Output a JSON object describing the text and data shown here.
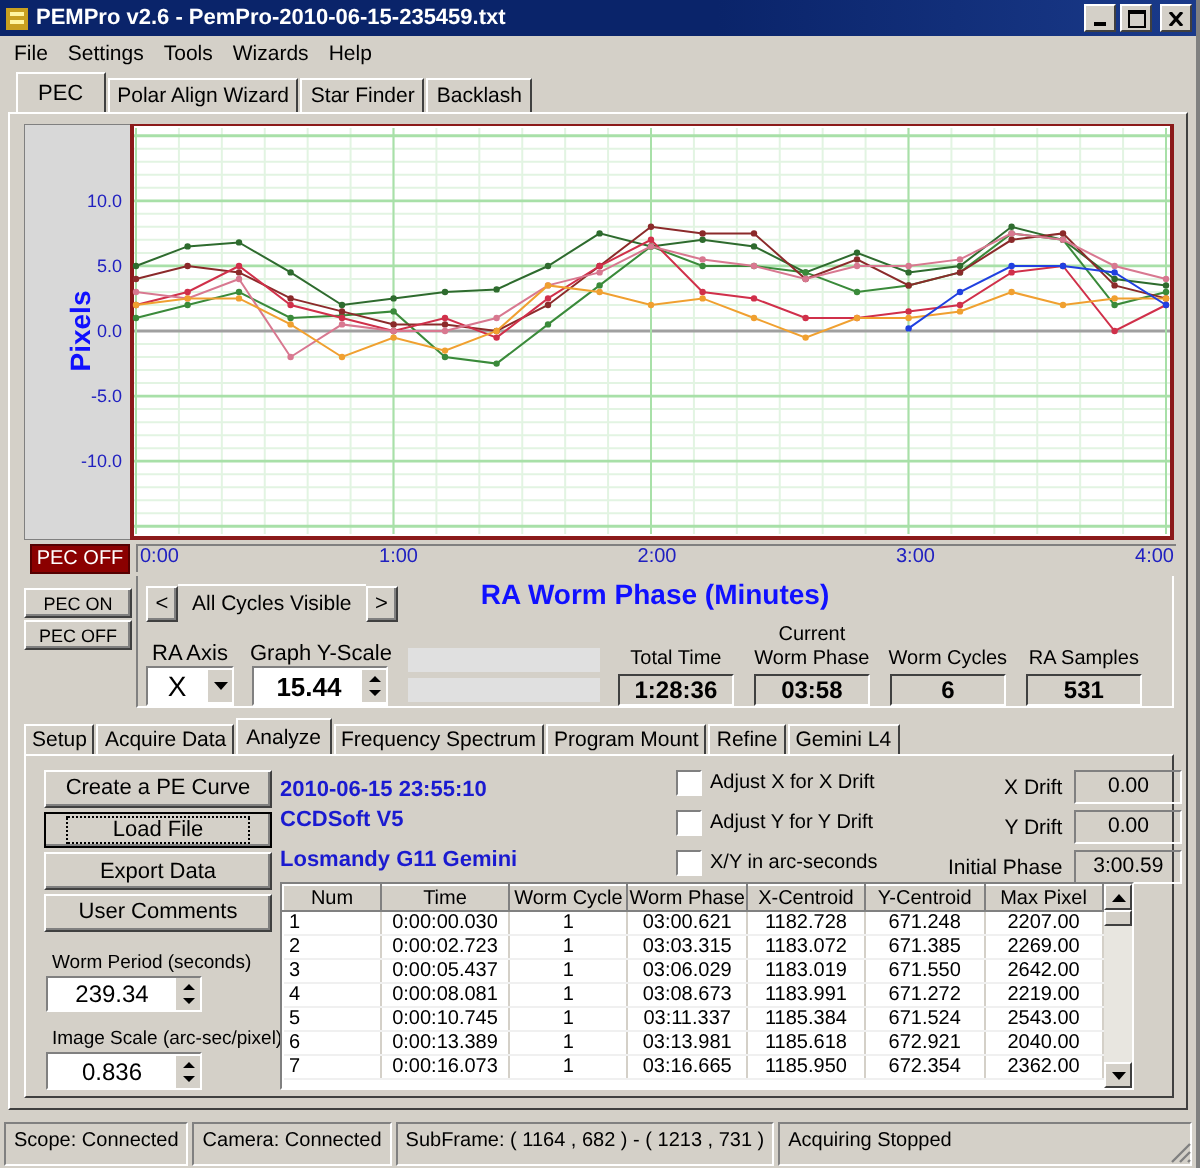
{
  "window": {
    "title": "PEMPro v2.6 - PemPro-2010-06-15-235459.txt"
  },
  "menu": [
    "File",
    "Settings",
    "Tools",
    "Wizards",
    "Help"
  ],
  "tabs": [
    {
      "label": "PEC",
      "selected": true
    },
    {
      "label": "Polar Align Wizard",
      "selected": false
    },
    {
      "label": "Star Finder",
      "selected": false
    },
    {
      "label": "Backlash",
      "selected": false
    }
  ],
  "pec_chart": {
    "status": "PEC OFF",
    "chart_data": {
      "type": "line",
      "grid": true,
      "xlabel": "RA Worm Phase (Minutes)",
      "ylabel": "Pixels",
      "xlim": [
        0,
        4
      ],
      "ylim": [
        -15.44,
        15.44
      ],
      "xticks": [
        {
          "value": 0,
          "label": "0:00"
        },
        {
          "value": 1,
          "label": "1:00"
        },
        {
          "value": 2,
          "label": "2:00"
        },
        {
          "value": 3,
          "label": "3:00"
        },
        {
          "value": 4,
          "label": "4:00"
        }
      ],
      "yticks": [
        {
          "value": 10,
          "label": "10.0"
        },
        {
          "value": 5,
          "label": "5.0"
        },
        {
          "value": 0,
          "label": "0.0"
        },
        {
          "value": -5,
          "label": "-5.0"
        },
        {
          "value": -10,
          "label": "-10.0"
        }
      ],
      "x": [
        0,
        0.2,
        0.4,
        0.6,
        0.8,
        1.0,
        1.2,
        1.4,
        1.6,
        1.8,
        2.0,
        2.2,
        2.4,
        2.6,
        2.8,
        3.0,
        3.2,
        3.4,
        3.6,
        3.8,
        4.0
      ],
      "series": [
        {
          "color": "#2e6b2e",
          "values": [
            5,
            6.5,
            6.8,
            4.5,
            2,
            2.5,
            3,
            3.2,
            5,
            7.5,
            6.5,
            7,
            6.5,
            4.5,
            6,
            4.5,
            5,
            8,
            7,
            4,
            3.5
          ]
        },
        {
          "color": "#3a8a3a",
          "values": [
            1,
            2,
            3,
            1,
            1.2,
            1.5,
            -2,
            -2.5,
            0.5,
            3.5,
            6.5,
            5,
            5,
            4.5,
            3,
            3.5,
            4.5,
            7.5,
            7,
            2,
            3
          ]
        },
        {
          "color": "#8b2a2a",
          "values": [
            4,
            5,
            4.5,
            2.5,
            1.5,
            0.5,
            0.5,
            0,
            2,
            5,
            8,
            7.5,
            7.5,
            4,
            5.5,
            3.5,
            4.5,
            7,
            7.5,
            3.5,
            2.5
          ]
        },
        {
          "color": "#d0304a",
          "values": [
            2,
            3,
            5,
            2,
            1,
            0,
            1,
            -0.5,
            2.5,
            5,
            7,
            3,
            2.5,
            1,
            1,
            1.5,
            2,
            4.5,
            5,
            0,
            2
          ]
        },
        {
          "color": "#d87890",
          "values": [
            3,
            2.5,
            4,
            -2,
            0.5,
            0,
            0,
            1,
            3.5,
            4.5,
            6.5,
            5.5,
            5,
            4,
            5,
            5,
            5.5,
            7.5,
            7,
            5,
            4
          ]
        },
        {
          "color": "#f0a030",
          "values": [
            2,
            2.5,
            2.5,
            0.5,
            -2,
            -0.5,
            -1.5,
            0,
            3.5,
            3,
            2,
            2.5,
            1,
            -0.5,
            1,
            1,
            1.5,
            3,
            2,
            2.5,
            2.5
          ]
        },
        {
          "color": "#2040e0",
          "values": [
            null,
            null,
            null,
            null,
            null,
            null,
            null,
            null,
            null,
            null,
            null,
            null,
            null,
            null,
            null,
            0.2,
            3,
            5,
            5,
            4.5,
            2
          ]
        }
      ]
    }
  },
  "pec_buttons": [
    "PEC ON",
    "PEC OFF"
  ],
  "cycle_selector": {
    "prev": "<",
    "label": "All Cycles Visible",
    "next": ">"
  },
  "ra_axis": {
    "label": "RA Axis",
    "value": "X"
  },
  "graph_y_scale": {
    "label": "Graph Y-Scale",
    "value": "15.44"
  },
  "stats": [
    {
      "label": "Total Time",
      "value": "1:28:36"
    },
    {
      "label": "Current Worm Phase",
      "value": "03:58"
    },
    {
      "label": "Worm Cycles",
      "value": "6"
    },
    {
      "label": "RA Samples",
      "value": "531"
    }
  ],
  "analysis_tabs": [
    {
      "label": "Setup",
      "selected": false
    },
    {
      "label": "Acquire Data",
      "selected": false
    },
    {
      "label": "Analyze",
      "selected": true
    },
    {
      "label": "Frequency Spectrum",
      "selected": false
    },
    {
      "label": "Program Mount",
      "selected": false
    },
    {
      "label": "Refine",
      "selected": false
    },
    {
      "label": "Gemini L4",
      "selected": false
    }
  ],
  "actions": [
    {
      "label": "Create a PE Curve",
      "focused": false
    },
    {
      "label": "Load File",
      "focused": true
    },
    {
      "label": "Export Data",
      "focused": false
    },
    {
      "label": "User Comments",
      "focused": false
    }
  ],
  "worm_period": {
    "label": "Worm Period (seconds)",
    "value": "239.34"
  },
  "image_scale": {
    "label": "Image Scale (arc-sec/pixel)",
    "value": "0.836"
  },
  "file_info": [
    "2010-06-15 23:55:10",
    "CCDSoft V5",
    "Losmandy G11 Gemini"
  ],
  "options": [
    {
      "label": "Adjust X for X Drift",
      "checked": false
    },
    {
      "label": "Adjust Y for Y Drift",
      "checked": false
    },
    {
      "label": "X/Y in arc-seconds",
      "checked": false
    }
  ],
  "drift": [
    {
      "label": "X Drift",
      "value": "0.00"
    },
    {
      "label": "Y Drift",
      "value": "0.00"
    },
    {
      "label": "Initial Phase",
      "value": "3:00.59"
    }
  ],
  "table": {
    "columns": [
      "Num",
      "Time",
      "Worm Cycle",
      "Worm Phase",
      "X-Centroid",
      "Y-Centroid",
      "Max Pixel"
    ],
    "rows": [
      [
        "1",
        "0:00:00.030",
        "1",
        "03:00.621",
        "1182.728",
        "671.248",
        "2207.00"
      ],
      [
        "2",
        "0:00:02.723",
        "1",
        "03:03.315",
        "1183.072",
        "671.385",
        "2269.00"
      ],
      [
        "3",
        "0:00:05.437",
        "1",
        "03:06.029",
        "1183.019",
        "671.550",
        "2642.00"
      ],
      [
        "4",
        "0:00:08.081",
        "1",
        "03:08.673",
        "1183.991",
        "671.272",
        "2219.00"
      ],
      [
        "5",
        "0:00:10.745",
        "1",
        "03:11.337",
        "1185.384",
        "671.524",
        "2543.00"
      ],
      [
        "6",
        "0:00:13.389",
        "1",
        "03:13.981",
        "1185.618",
        "672.921",
        "2040.00"
      ],
      [
        "7",
        "0:00:16.073",
        "1",
        "03:16.665",
        "1185.950",
        "672.354",
        "2362.00"
      ]
    ]
  },
  "status_bar": [
    "Scope: Connected",
    "Camera: Connected",
    "SubFrame: ( 1164 , 682 ) - ( 1213 , 731 )",
    "Acquiring Stopped"
  ]
}
